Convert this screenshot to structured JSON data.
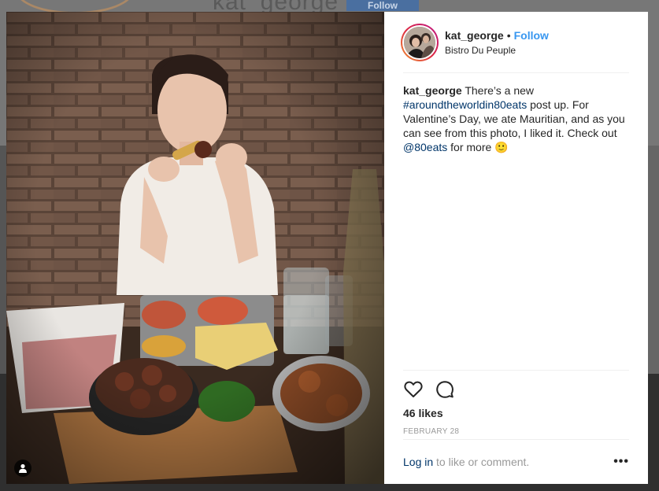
{
  "background": {
    "username": "kat_george",
    "follow_label": "Follow"
  },
  "post": {
    "username": "kat_george",
    "separator": "•",
    "follow_label": "Follow",
    "location": "Bistro Du Peuple",
    "caption": {
      "username": "kat_george",
      "text_1": " There’s a new ",
      "hashtag": "#aroundtheworldin80eats",
      "text_2": " post up. For Valentine’s Day, we ate Mauritian, and as you can see from this photo, I liked it. Check out ",
      "mention": "@80eats",
      "text_3": " for more 🙂"
    },
    "likes": "46 likes",
    "date": "FEBRUARY 28",
    "login_link": "Log in",
    "login_text": " to like or comment.",
    "more_label": "•••"
  },
  "icons": {
    "like": "heart-icon",
    "comment": "comment-icon",
    "user_tag": "person-icon"
  },
  "colors": {
    "follow": "#3897f0",
    "link": "#003569",
    "muted": "#999999",
    "text": "#262626"
  }
}
